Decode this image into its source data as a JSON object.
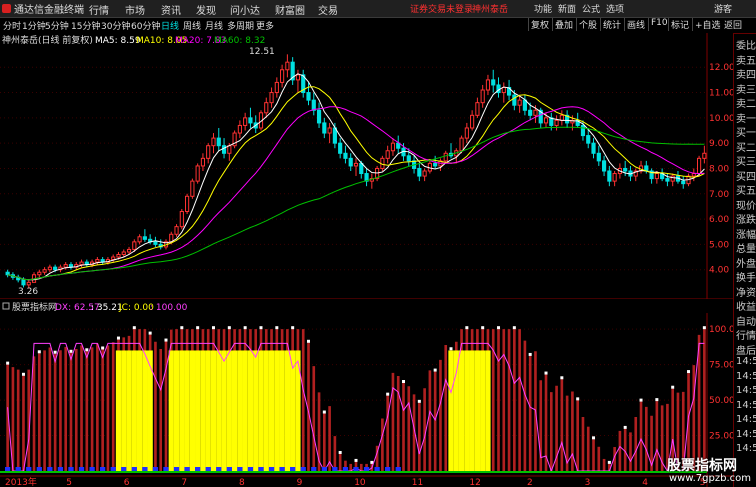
{
  "app": {
    "title": "通达信金融终端"
  },
  "menu": [
    "行情",
    "市场",
    "资讯",
    "发现",
    "问小达",
    "财富圈",
    "交易"
  ],
  "alert": "证券交易未登录",
  "stock_name_top": "神州泰岳",
  "top_right": [
    "功能",
    "新面",
    "公式",
    "选项",
    "游客"
  ],
  "periods": [
    "分时",
    "1分钟",
    "5分钟",
    "15分钟",
    "30分钟",
    "60分钟",
    "日线",
    "周线",
    "月线",
    "多周期",
    "更多"
  ],
  "active_period": "日线",
  "toolbar_right": [
    "复权",
    "叠加",
    "个股",
    "统计",
    "画线",
    "F10",
    "标记",
    "+自选",
    "返回"
  ],
  "main_legend": {
    "name": "神州泰岳(日线 前复权)",
    "ma5": "MA5: 8.59",
    "ma10": "MA10: 8.05",
    "ma20": "MA20: 7.83",
    "ma60": "MA60: 8.32"
  },
  "high_label": "12.51",
  "low_label": "3.26",
  "price_axis": [
    "12.00",
    "11.00",
    "10.00",
    "9.00",
    "8.00",
    "7.00",
    "6.00",
    "5.00",
    "4.00"
  ],
  "indicator_legend": {
    "name": "股票指标网",
    "dx": "DX: 62.57",
    "v2": ": 35.21",
    "jc": "JC: 0.00",
    "v4": ": 100.00"
  },
  "ind_axis": [
    "100.00",
    "75.00",
    "50.00",
    "25.00"
  ],
  "date_axis": [
    "2013年",
    "5",
    "6",
    "7",
    "8",
    "9",
    "10",
    "11",
    "12",
    "2",
    "3",
    "4",
    "5"
  ],
  "right_labels": [
    "委比",
    "卖五",
    "卖四",
    "卖三",
    "卖二",
    "卖一",
    "买一",
    "买二",
    "买三",
    "买四",
    "买五",
    "现价",
    "涨跌",
    "涨幅",
    "总量",
    "外盘",
    "换手",
    "净资",
    "收益",
    "自动",
    "行情",
    "盘后",
    "14:5",
    "14:5",
    "14:5",
    "14:5",
    "14:5",
    "14:5",
    "14:5"
  ],
  "watermark": {
    "line1": "股票指标网",
    "line2": "www.7gpzb.com"
  },
  "colors": {
    "up": "#ff3232",
    "down": "#00e0e0",
    "ma5": "#ffffff",
    "ma10": "#ffff00",
    "ma20": "#ff00ff",
    "ma60": "#00c000",
    "accent": "#ff3030"
  },
  "chart_data": {
    "type": "candlestick",
    "price_range": [
      3.0,
      12.8
    ],
    "ohlc": [
      [
        3.9,
        4.0,
        3.7,
        3.8
      ],
      [
        3.8,
        3.9,
        3.6,
        3.7
      ],
      [
        3.7,
        3.8,
        3.5,
        3.6
      ],
      [
        3.6,
        3.7,
        3.3,
        3.4
      ],
      [
        3.4,
        3.6,
        3.26,
        3.5
      ],
      [
        3.5,
        3.9,
        3.5,
        3.8
      ],
      [
        3.8,
        4.0,
        3.7,
        3.9
      ],
      [
        3.9,
        4.1,
        3.8,
        4.0
      ],
      [
        4.0,
        4.2,
        3.9,
        4.1
      ],
      [
        4.1,
        4.2,
        3.9,
        4.0
      ],
      [
        4.0,
        4.2,
        3.9,
        4.1
      ],
      [
        4.1,
        4.3,
        4.0,
        4.2
      ],
      [
        4.2,
        4.3,
        4.0,
        4.1
      ],
      [
        4.1,
        4.3,
        4.0,
        4.2
      ],
      [
        4.2,
        4.4,
        4.1,
        4.3
      ],
      [
        4.3,
        4.4,
        4.1,
        4.2
      ],
      [
        4.2,
        4.4,
        4.1,
        4.3
      ],
      [
        4.3,
        4.5,
        4.2,
        4.4
      ],
      [
        4.4,
        4.5,
        4.2,
        4.3
      ],
      [
        4.3,
        4.5,
        4.2,
        4.4
      ],
      [
        4.4,
        4.6,
        4.3,
        4.5
      ],
      [
        4.5,
        4.7,
        4.4,
        4.6
      ],
      [
        4.6,
        4.8,
        4.5,
        4.7
      ],
      [
        4.7,
        4.9,
        4.6,
        4.8
      ],
      [
        4.8,
        5.2,
        4.7,
        5.1
      ],
      [
        5.1,
        5.4,
        5.0,
        5.3
      ],
      [
        5.3,
        5.6,
        5.1,
        5.2
      ],
      [
        5.2,
        5.4,
        5.0,
        5.1
      ],
      [
        5.1,
        5.3,
        4.9,
        5.0
      ],
      [
        5.0,
        5.2,
        4.8,
        4.9
      ],
      [
        4.9,
        5.2,
        4.8,
        5.1
      ],
      [
        5.1,
        5.5,
        5.0,
        5.4
      ],
      [
        5.4,
        5.8,
        5.3,
        5.7
      ],
      [
        5.7,
        6.4,
        5.6,
        6.3
      ],
      [
        6.3,
        7.0,
        6.2,
        6.9
      ],
      [
        6.9,
        7.6,
        6.8,
        7.5
      ],
      [
        7.5,
        8.2,
        7.4,
        8.1
      ],
      [
        8.1,
        8.6,
        7.9,
        8.4
      ],
      [
        8.4,
        9.0,
        8.2,
        8.9
      ],
      [
        8.9,
        9.4,
        8.6,
        9.2
      ],
      [
        9.2,
        9.6,
        8.7,
        8.9
      ],
      [
        8.9,
        9.2,
        8.4,
        8.6
      ],
      [
        8.6,
        9.0,
        8.3,
        8.9
      ],
      [
        8.9,
        9.5,
        8.8,
        9.4
      ],
      [
        9.4,
        9.9,
        9.2,
        9.7
      ],
      [
        9.7,
        10.2,
        9.5,
        10.0
      ],
      [
        10.0,
        10.4,
        9.6,
        9.8
      ],
      [
        9.8,
        10.1,
        9.4,
        9.6
      ],
      [
        9.6,
        10.3,
        9.5,
        10.2
      ],
      [
        10.2,
        10.8,
        10.0,
        10.6
      ],
      [
        10.6,
        11.2,
        10.4,
        11.0
      ],
      [
        11.0,
        11.6,
        10.8,
        11.4
      ],
      [
        11.4,
        12.1,
        11.2,
        11.9
      ],
      [
        11.9,
        12.51,
        11.6,
        12.2
      ],
      [
        12.2,
        12.4,
        11.3,
        11.5
      ],
      [
        11.5,
        11.9,
        11.0,
        11.7
      ],
      [
        11.7,
        11.9,
        10.8,
        11.0
      ],
      [
        11.0,
        11.4,
        10.5,
        10.7
      ],
      [
        10.7,
        11.0,
        10.1,
        10.3
      ],
      [
        10.3,
        10.6,
        9.6,
        9.8
      ],
      [
        9.8,
        10.0,
        9.2,
        9.4
      ],
      [
        9.4,
        9.8,
        9.0,
        9.6
      ],
      [
        9.6,
        9.8,
        8.8,
        9.0
      ],
      [
        9.0,
        9.2,
        8.4,
        8.6
      ],
      [
        8.6,
        8.9,
        8.2,
        8.4
      ],
      [
        8.4,
        8.6,
        7.9,
        8.1
      ],
      [
        8.1,
        8.4,
        7.7,
        8.2
      ],
      [
        8.2,
        8.3,
        7.6,
        7.8
      ],
      [
        7.8,
        8.0,
        7.3,
        7.5
      ],
      [
        7.5,
        7.8,
        7.2,
        7.6
      ],
      [
        7.6,
        8.1,
        7.5,
        8.0
      ],
      [
        8.0,
        8.5,
        7.9,
        8.4
      ],
      [
        8.4,
        8.9,
        8.2,
        8.7
      ],
      [
        8.7,
        9.2,
        8.5,
        9.0
      ],
      [
        9.0,
        9.3,
        8.6,
        8.8
      ],
      [
        8.8,
        9.0,
        8.3,
        8.5
      ],
      [
        8.5,
        8.8,
        8.1,
        8.3
      ],
      [
        8.3,
        8.5,
        7.8,
        8.0
      ],
      [
        8.0,
        8.2,
        7.5,
        7.7
      ],
      [
        7.7,
        8.0,
        7.5,
        7.9
      ],
      [
        7.9,
        8.3,
        7.8,
        8.2
      ],
      [
        8.2,
        8.5,
        8.0,
        8.1
      ],
      [
        8.1,
        8.4,
        7.9,
        8.3
      ],
      [
        8.3,
        8.7,
        8.2,
        8.6
      ],
      [
        8.6,
        9.0,
        8.4,
        8.5
      ],
      [
        8.5,
        8.8,
        8.2,
        8.7
      ],
      [
        8.7,
        9.3,
        8.6,
        9.2
      ],
      [
        9.2,
        9.8,
        9.0,
        9.6
      ],
      [
        9.6,
        10.3,
        9.5,
        10.1
      ],
      [
        10.1,
        10.8,
        10.0,
        10.6
      ],
      [
        10.6,
        11.3,
        10.4,
        11.1
      ],
      [
        11.1,
        11.7,
        10.9,
        11.5
      ],
      [
        11.5,
        11.9,
        11.0,
        11.3
      ],
      [
        11.3,
        11.6,
        10.8,
        11.0
      ],
      [
        11.0,
        11.4,
        10.6,
        11.2
      ],
      [
        11.2,
        11.5,
        10.7,
        10.9
      ],
      [
        10.9,
        11.1,
        10.3,
        10.5
      ],
      [
        10.5,
        10.9,
        10.2,
        10.7
      ],
      [
        10.7,
        10.9,
        10.1,
        10.3
      ],
      [
        10.3,
        10.6,
        9.9,
        10.1
      ],
      [
        10.1,
        10.5,
        9.8,
        10.3
      ],
      [
        10.3,
        10.4,
        9.6,
        9.8
      ],
      [
        9.8,
        10.2,
        9.6,
        10.0
      ],
      [
        10.0,
        10.2,
        9.5,
        9.7
      ],
      [
        9.7,
        10.1,
        9.5,
        9.9
      ],
      [
        9.9,
        10.3,
        9.7,
        10.1
      ],
      [
        10.1,
        10.3,
        9.6,
        9.8
      ],
      [
        9.8,
        10.1,
        9.5,
        9.9
      ],
      [
        9.9,
        10.2,
        9.6,
        9.7
      ],
      [
        9.7,
        9.9,
        9.1,
        9.3
      ],
      [
        9.3,
        9.6,
        8.8,
        9.0
      ],
      [
        9.0,
        9.2,
        8.4,
        8.6
      ],
      [
        8.6,
        8.9,
        8.1,
        8.3
      ],
      [
        8.3,
        8.5,
        7.7,
        7.9
      ],
      [
        7.9,
        8.1,
        7.3,
        7.5
      ],
      [
        7.5,
        7.9,
        7.3,
        7.8
      ],
      [
        7.8,
        8.2,
        7.6,
        8.0
      ],
      [
        8.0,
        8.3,
        7.7,
        7.9
      ],
      [
        7.9,
        8.1,
        7.5,
        7.7
      ],
      [
        7.7,
        8.0,
        7.5,
        7.9
      ],
      [
        7.9,
        8.3,
        7.8,
        8.1
      ],
      [
        8.1,
        8.3,
        7.8,
        7.9
      ],
      [
        7.9,
        8.0,
        7.4,
        7.6
      ],
      [
        7.6,
        7.9,
        7.4,
        7.8
      ],
      [
        7.8,
        8.0,
        7.5,
        7.6
      ],
      [
        7.6,
        7.8,
        7.3,
        7.5
      ],
      [
        7.5,
        7.8,
        7.3,
        7.7
      ],
      [
        7.7,
        7.9,
        7.4,
        7.5
      ],
      [
        7.5,
        7.7,
        7.2,
        7.4
      ],
      [
        7.4,
        7.8,
        7.3,
        7.7
      ],
      [
        7.7,
        8.0,
        7.5,
        7.8
      ],
      [
        7.8,
        8.5,
        7.7,
        8.4
      ],
      [
        8.4,
        8.9,
        8.2,
        8.6
      ]
    ]
  }
}
